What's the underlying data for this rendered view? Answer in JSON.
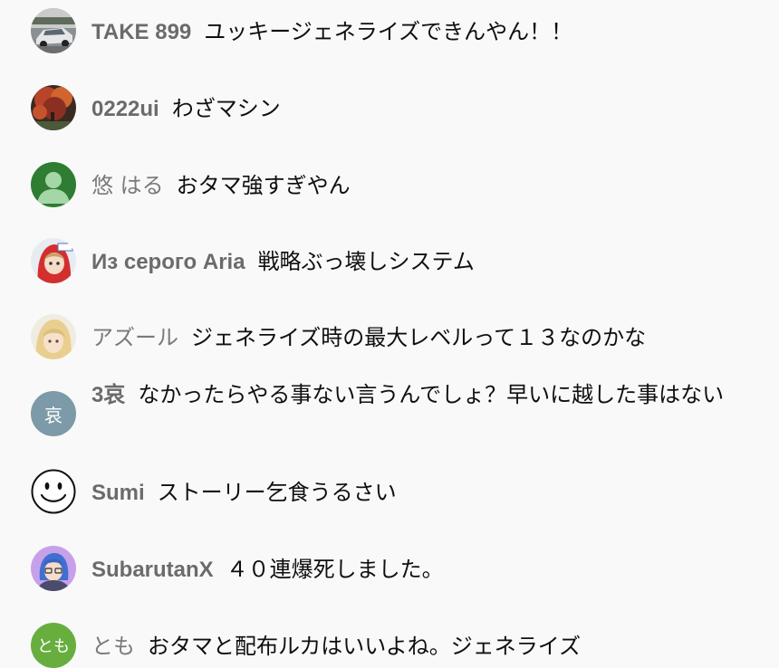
{
  "chat": {
    "messages": [
      {
        "author": "TAKE 899",
        "text": "ユッキージェネライズできんやん！！",
        "avatar": "car-photo-icon"
      },
      {
        "author": "0222ui",
        "text": "わざマシン",
        "avatar": "autumn-tree-photo-icon"
      },
      {
        "author": "悠 はる",
        "text": "おタマ強すぎやん",
        "avatar": "default-user-icon",
        "avatar_color": "#2e7d32"
      },
      {
        "author": "Из серого Aria",
        "text": "戦略ぶっ壊しシステム",
        "avatar": "anime-character-red-hood-icon"
      },
      {
        "author": "アズール",
        "text": "ジェネライズ時の最大レベルって１３なのかな",
        "avatar": "anime-girl-blonde-icon"
      },
      {
        "author": "3哀",
        "text": "なかったらやる事ない言うんでしょ？早いに越した事はない",
        "avatar_letter": "哀",
        "avatar_color": "#7c9aa8"
      },
      {
        "author": "Sumi",
        "text": "ストーリー乞食うるさい",
        "avatar": "smiley-face-icon"
      },
      {
        "author": "SubarutanX",
        "text": "４０連爆死しました。",
        "avatar": "anime-boy-glasses-purple-icon"
      },
      {
        "author": "とも",
        "text": "おタマと配布ルカはいいよね。ジェネライズ",
        "avatar_letter": "とも",
        "avatar_color": "#67ae3e"
      }
    ]
  }
}
